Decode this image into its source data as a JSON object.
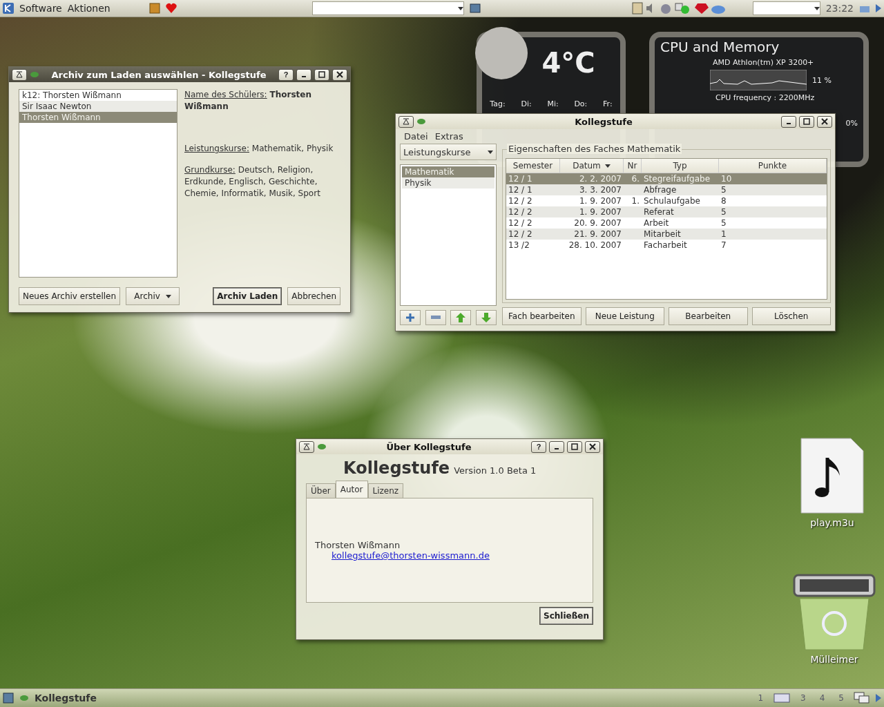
{
  "top_panel": {
    "menus": [
      "Software",
      "Aktionen"
    ],
    "clock": "23:22"
  },
  "weather": {
    "temperature": "4°C",
    "days": [
      "Tag:",
      "Di:",
      "Mi:",
      "Do:",
      "Fr:"
    ]
  },
  "cpu": {
    "title": "CPU and Memory",
    "processor": "AMD Athlon(tm) XP 3200+",
    "usage": "11 %",
    "frequency": "CPU frequency : 2200MHz",
    "swap_usage": "0%"
  },
  "archive_window": {
    "title": "Archiv zum Laden auswählen - Kollegstufe",
    "help_label": "?",
    "archives": [
      {
        "label": "k12: Thorsten Wißmann",
        "selected": false
      },
      {
        "label": "Sir Isaac Newton",
        "selected": false
      },
      {
        "label": "Thorsten Wißmann",
        "selected": true
      }
    ],
    "details": [
      {
        "label": "Name des Schülers:",
        "value": "Thorsten Wißmann",
        "kind": "name"
      },
      {
        "label": "Leistungskurse:",
        "value": "Mathematik, Physik",
        "kind": "plain"
      },
      {
        "label": "Grundkurse:",
        "value": "Deutsch, Religion, Erdkunde, Englisch, Geschichte, Chemie, Informatik, Musik, Sport",
        "kind": "plain"
      }
    ],
    "buttons": [
      {
        "label": "Neues Archiv erstellen",
        "kind": "plain"
      },
      {
        "label": "Archiv",
        "kind": "menu"
      },
      {
        "label": "Archiv Laden",
        "kind": "default"
      },
      {
        "label": "Abbrechen",
        "kind": "plain"
      }
    ]
  },
  "main_window": {
    "title": "Kollegstufe",
    "menus": [
      "Datei",
      "Extras"
    ],
    "course_type": "Leistungskurse",
    "subjects": [
      {
        "label": "Mathematik",
        "selected": true
      },
      {
        "label": "Physik",
        "selected": false
      }
    ],
    "group_title": "Eigenschaften des Faches Mathematik",
    "columns": [
      {
        "label": "Semester",
        "sorted": false
      },
      {
        "label": "Datum",
        "sorted": true
      },
      {
        "label": "Nr",
        "sorted": false
      },
      {
        "label": "Typ",
        "sorted": false
      },
      {
        "label": "Punkte",
        "sorted": false
      }
    ],
    "rows": [
      {
        "cells": [
          "12 / 1",
          "2.  2. 2007",
          "6.",
          "Stegreifaufgabe",
          "10"
        ],
        "selected": true
      },
      {
        "cells": [
          "12 / 1",
          "3.  3. 2007",
          "",
          "Abfrage",
          "5"
        ],
        "selected": false
      },
      {
        "cells": [
          "12 / 2",
          "1.  9. 2007",
          "1.",
          "Schulaufgabe",
          "8"
        ],
        "selected": false
      },
      {
        "cells": [
          "12 / 2",
          "1.  9. 2007",
          "",
          "Referat",
          "5"
        ],
        "selected": false
      },
      {
        "cells": [
          "12 / 2",
          "20.  9. 2007",
          "",
          "Arbeit",
          "5"
        ],
        "selected": false
      },
      {
        "cells": [
          "12 / 2",
          "21.  9. 2007",
          "",
          "Mitarbeit",
          "1"
        ],
        "selected": false
      },
      {
        "cells": [
          "13 /2",
          "28. 10. 2007",
          "",
          "Facharbeit",
          "7"
        ],
        "selected": false
      }
    ],
    "tool_buttons": [
      {
        "kind": "add"
      },
      {
        "kind": "remove"
      },
      {
        "kind": "up"
      },
      {
        "kind": "down"
      }
    ],
    "buttons": [
      "Fach bearbeiten",
      "Neue Leistung",
      "Bearbeiten",
      "Löschen"
    ]
  },
  "about_window": {
    "title": "Über Kollegstufe",
    "help_label": "?",
    "app_name": "Kollegstufe",
    "version": "Version 1.0 Beta 1",
    "tabs": [
      {
        "label": "Über",
        "selected": false
      },
      {
        "label": "Autor",
        "selected": true
      },
      {
        "label": "Lizenz",
        "selected": false
      }
    ],
    "author": "Thorsten Wißmann",
    "email": "kollegstufe@thorsten-wissmann.de",
    "close_button": "Schließen"
  },
  "desktop_icons": [
    {
      "label": "play.m3u",
      "kind": "audio"
    },
    {
      "label": "Mülleimer",
      "kind": "trash"
    }
  ],
  "bottom_panel": {
    "task": "Kollegstufe",
    "desktops": [
      {
        "label": "1",
        "selected": false
      },
      {
        "label": "3",
        "selected": false
      },
      {
        "label": "4",
        "selected": false
      },
      {
        "label": "5",
        "selected": false
      }
    ]
  }
}
